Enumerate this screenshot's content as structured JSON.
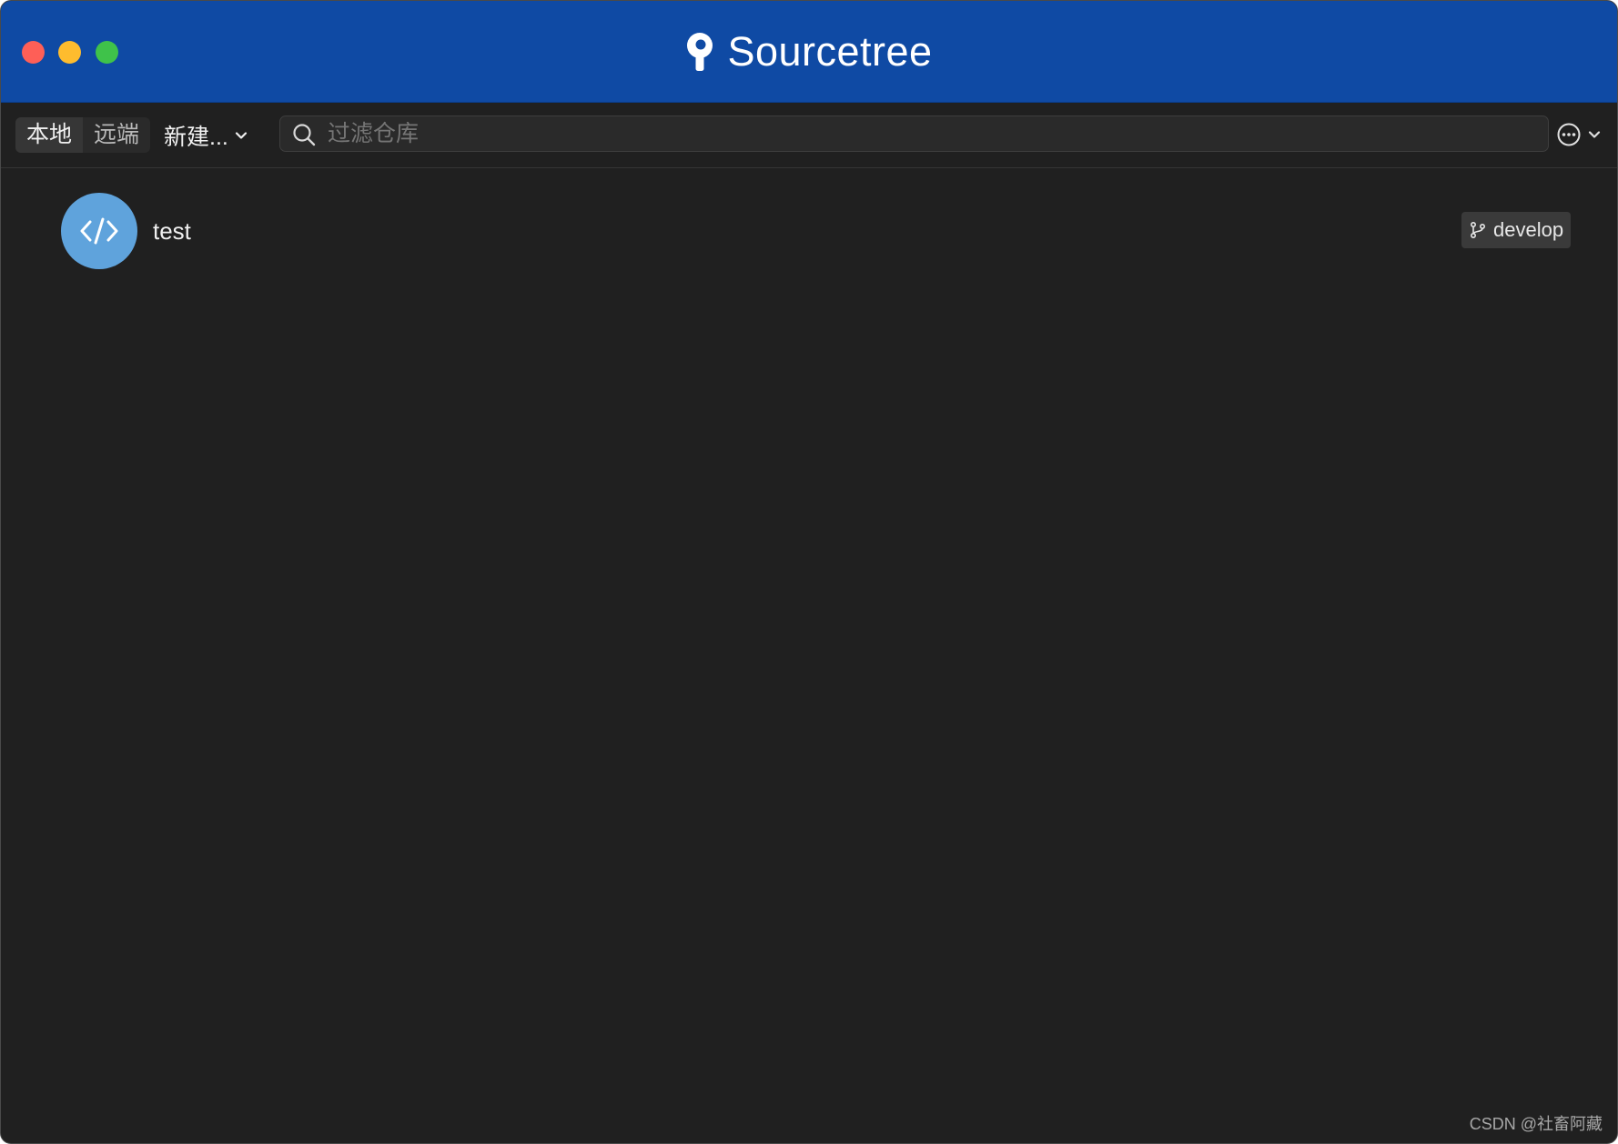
{
  "window": {
    "title": "Sourcetree",
    "controls": [
      "close",
      "minimize",
      "zoom"
    ]
  },
  "toolbar": {
    "tabs": [
      {
        "label": "本地",
        "active": true
      },
      {
        "label": "远端",
        "active": false
      }
    ],
    "new_label": "新建...",
    "search_placeholder": "过滤仓库",
    "search_value": ""
  },
  "repos": [
    {
      "name": "test",
      "branch": "develop",
      "icon": "code-icon"
    }
  ],
  "watermark": "CSDN @社畜阿藏",
  "colors": {
    "titlebar": "#0f4aa4",
    "background": "#202020",
    "repo_avatar": "#5fa3dc",
    "badge": "#3a3a3a"
  },
  "icons": [
    "sourcetree-logo-icon",
    "search-icon",
    "chevron-down-icon",
    "more-options-icon",
    "code-icon",
    "branch-icon"
  ]
}
